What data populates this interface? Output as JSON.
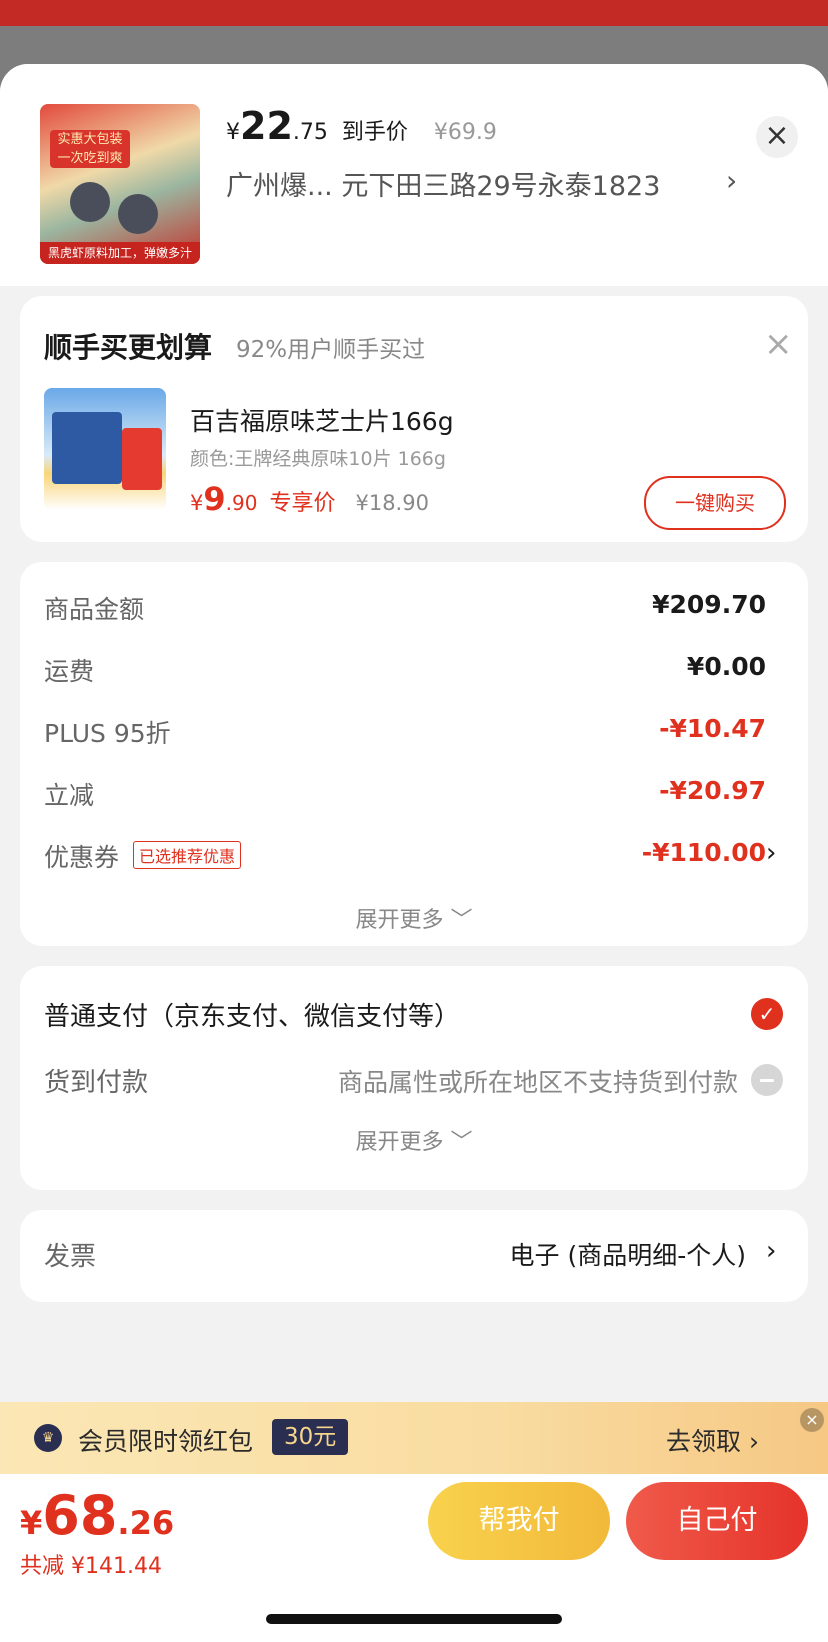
{
  "product_header": {
    "price_currency": "¥",
    "price_int": "22",
    "price_dec": ".75",
    "price_tag": "到手价",
    "original_price": "¥69.9",
    "address": "广州爆...  元下田三路29号永泰1823",
    "image_text_top": "实惠大包装 一次吃到爽",
    "image_text_bottom": "黑虎虾原料加工，弹嫩多汁"
  },
  "bundle": {
    "title": "顺手买更划算",
    "subtitle": "92%用户顺手买过",
    "item": {
      "name": "百吉福原味芝士片166g",
      "spec": "颜色:王牌经典原味10片 166g",
      "price_currency": "¥",
      "price_int": "9",
      "price_dec": ".90",
      "price_tag": "专享价",
      "original_price": "¥18.90",
      "buy_label": "一键购买"
    }
  },
  "summary": {
    "rows": [
      {
        "label": "商品金额",
        "value": "¥209.70"
      },
      {
        "label": "运费",
        "value": "¥0.00"
      },
      {
        "label": "PLUS 95折",
        "value": "-¥10.47"
      },
      {
        "label": "立减",
        "value": "-¥20.97"
      },
      {
        "label": "优惠券",
        "value": "-¥110.00",
        "badge": "已选推荐优惠"
      }
    ],
    "expand_label": "展开更多 ﹀"
  },
  "payment": {
    "standard_label": "普通支付（京东支付、微信支付等）",
    "cod_label": "货到付款",
    "cod_note": "商品属性或所在地区不支持货到付款",
    "expand_label": "展开更多 ﹀"
  },
  "invoice": {
    "label": "发票",
    "value": "电子 (商品明细-个人)"
  },
  "promo": {
    "text": "会员限时领红包",
    "amount": "30元",
    "action": "去领取 ›"
  },
  "checkout": {
    "total_currency": "¥",
    "total_int": "68",
    "total_dec": ".26",
    "saved": "共减 ¥141.44",
    "help_pay_label": "帮我付",
    "self_pay_label": "自己付"
  },
  "colors": {
    "accent_red": "#e0301e",
    "promo_gold": "#f8d24c"
  },
  "icons": {
    "close": "close-icon",
    "chevron": "chevron-right-icon",
    "check": "check-circle-icon",
    "disabled": "disabled-circle-icon",
    "crown": "vip-crown-icon"
  }
}
